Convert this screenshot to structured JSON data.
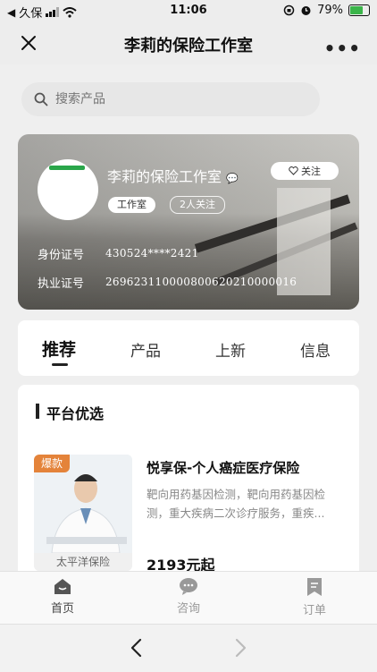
{
  "status_bar": {
    "carrier": "久保",
    "time": "11:06",
    "battery": "79%",
    "battery_level": 0.79
  },
  "title_bar": {
    "title": "李莉的保险工作室"
  },
  "search": {
    "placeholder": "搜索产品"
  },
  "profile": {
    "name": "李莉的保险工作室",
    "tag_studio": "工作室",
    "followers": "2人关注",
    "follow_label": "关注",
    "id_label": "身份证号",
    "id_value": "430524****2421",
    "license_label": "执业证号",
    "license_value": "269623110000800620210000016"
  },
  "tabs": [
    "推荐",
    "产品",
    "上新",
    "信息"
  ],
  "section": {
    "title": "平台优选"
  },
  "product": {
    "badge": "爆款",
    "title": "悦享保-个人癌症医疗保险",
    "desc": "靶向用药基因检测，靶向用药基因检测，重大疾病二次诊疗服务，重疾...",
    "brand": "太平洋保险",
    "price": "2193元起"
  },
  "bottom_nav": [
    "首页",
    "咨询",
    "订单"
  ],
  "colors": {
    "accent_green": "#2aa64a",
    "badge_orange": "#e4833a"
  }
}
